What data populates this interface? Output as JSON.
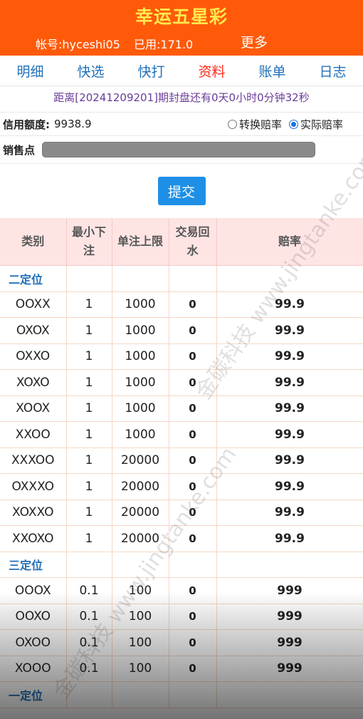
{
  "header": {
    "title": "幸运五星彩",
    "account": "帐号:hyceshi05",
    "used": "已用:171.0",
    "more": "更多"
  },
  "nav": [
    "明细",
    "快选",
    "快打",
    "资料",
    "账单",
    "日志"
  ],
  "countdown": "距离[20241209201]期封盘还有0天0小时0分钟32秒",
  "credit": {
    "label": "信用额度:",
    "value": "9938.9",
    "radio1": "转换赔率",
    "radio2": "实际赔率"
  },
  "sale": {
    "label": "销售点"
  },
  "submit": "提交",
  "table": {
    "headers": [
      "类别",
      "最小下注",
      "单注上限",
      "交易回水",
      "赔率"
    ],
    "groups": [
      {
        "name": "二定位",
        "rows": [
          [
            "OOXX",
            "1",
            "1000",
            "0",
            "99.9"
          ],
          [
            "OXOX",
            "1",
            "1000",
            "0",
            "99.9"
          ],
          [
            "OXXO",
            "1",
            "1000",
            "0",
            "99.9"
          ],
          [
            "XOXO",
            "1",
            "1000",
            "0",
            "99.9"
          ],
          [
            "XOOX",
            "1",
            "1000",
            "0",
            "99.9"
          ],
          [
            "XXOO",
            "1",
            "1000",
            "0",
            "99.9"
          ],
          [
            "XXXOO",
            "1",
            "20000",
            "0",
            "99.9"
          ],
          [
            "OXXXO",
            "1",
            "20000",
            "0",
            "99.9"
          ],
          [
            "XOXXO",
            "1",
            "20000",
            "0",
            "99.9"
          ],
          [
            "XXOXO",
            "1",
            "20000",
            "0",
            "99.9"
          ]
        ]
      },
      {
        "name": "三定位",
        "rows": [
          [
            "OOOX",
            "0.1",
            "100",
            "0",
            "999"
          ],
          [
            "OOXO",
            "0.1",
            "100",
            "0",
            "999"
          ],
          [
            "OXOO",
            "0.1",
            "100",
            "0",
            "999"
          ],
          [
            "XOOO",
            "0.1",
            "100",
            "0",
            "999"
          ]
        ]
      },
      {
        "name": "一定位",
        "rows": []
      }
    ]
  },
  "watermark": {
    "cn": "金碳科技",
    "url": "www.jingtanke.com"
  }
}
